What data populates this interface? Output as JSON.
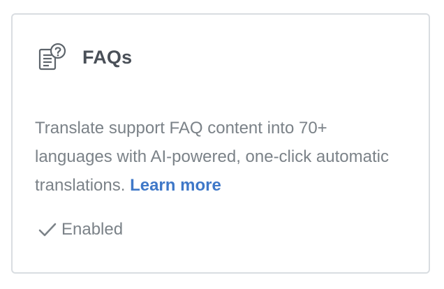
{
  "card": {
    "title": "FAQs",
    "icon": "faq-icon",
    "description": "Translate support FAQ content into 70+ languages with AI-powered, one-click automatic translations.",
    "link_label": "Learn more",
    "status_icon": "checkmark-icon",
    "status_label": "Enabled"
  },
  "colors": {
    "title": "#4a5058",
    "body_text": "#7b8288",
    "link": "#3f78c8",
    "border": "#d9dde1"
  }
}
